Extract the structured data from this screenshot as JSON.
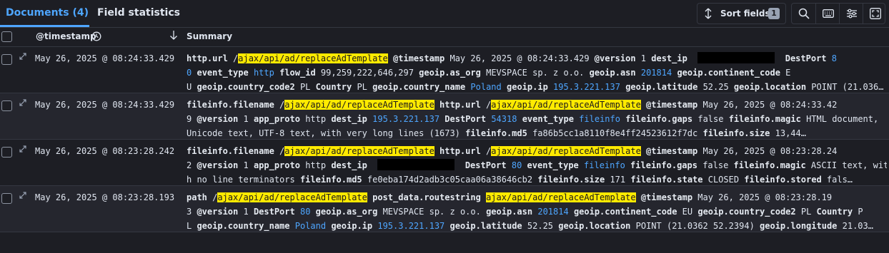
{
  "tabs": [
    {
      "label": "Documents (4)",
      "active": true
    },
    {
      "label": "Field statistics",
      "active": false
    }
  ],
  "toolbar": {
    "sort_label": "Sort fields",
    "sort_count": "1",
    "icons": [
      "search-icon",
      "keyboard-icon",
      "settings-sliders-icon",
      "fullscreen-icon"
    ]
  },
  "columns": {
    "timestamp": "@timestamp",
    "summary": "Summary"
  },
  "colors": {
    "accent": "#4ea6ff",
    "highlight": "#ffea00",
    "background": "#1d1e24"
  },
  "rows": [
    {
      "timestamp": "May 26, 2025 @ 08:24:33.429",
      "lines": [
        [
          [
            "k",
            "http.url"
          ],
          [
            "t",
            " /"
          ],
          [
            "h",
            "ajax/api/ad/replaceAdTemplate"
          ],
          [
            "t",
            " "
          ],
          [
            "k",
            "@timestamp"
          ],
          [
            "t",
            " May 26, 2025 @ 08:24:33.429 "
          ],
          [
            "k",
            "@version"
          ],
          [
            "t",
            " 1 "
          ],
          [
            "k",
            "dest_ip"
          ],
          [
            "t",
            "  "
          ],
          [
            "r",
            ""
          ],
          [
            "t",
            "  "
          ],
          [
            "k",
            "DestPort"
          ],
          [
            "t",
            " "
          ],
          [
            "n",
            "8"
          ]
        ],
        [
          [
            "n",
            "0"
          ],
          [
            "t",
            " "
          ],
          [
            "k",
            "event_type"
          ],
          [
            "t",
            " "
          ],
          [
            "n",
            "http"
          ],
          [
            "t",
            " "
          ],
          [
            "k",
            "flow_id"
          ],
          [
            "t",
            " 99,259,222,646,297 "
          ],
          [
            "k",
            "geoip.as_org"
          ],
          [
            "t",
            " MEVSPACE sp. z o.o. "
          ],
          [
            "k",
            "geoip.asn"
          ],
          [
            "t",
            " "
          ],
          [
            "n",
            "201814"
          ],
          [
            "t",
            " "
          ],
          [
            "k",
            "geoip.continent_code"
          ],
          [
            "t",
            " E"
          ]
        ],
        [
          [
            "t",
            "U "
          ],
          [
            "k",
            "geoip.country_code2"
          ],
          [
            "t",
            " PL "
          ],
          [
            "k",
            "Country"
          ],
          [
            "t",
            " PL "
          ],
          [
            "k",
            "geoip.country_name"
          ],
          [
            "t",
            " "
          ],
          [
            "n",
            "Poland"
          ],
          [
            "t",
            " "
          ],
          [
            "k",
            "geoip.ip"
          ],
          [
            "t",
            " "
          ],
          [
            "n",
            "195.3.221.137"
          ],
          [
            "t",
            " "
          ],
          [
            "k",
            "geoip.latitude"
          ],
          [
            "t",
            " 52.25 "
          ],
          [
            "k",
            "geoip.location"
          ],
          [
            "t",
            " POINT (21.036…"
          ]
        ]
      ]
    },
    {
      "timestamp": "May 26, 2025 @ 08:24:33.429",
      "lines": [
        [
          [
            "k",
            "fileinfo.filename"
          ],
          [
            "t",
            " /"
          ],
          [
            "h",
            "ajax/api/ad/replaceAdTemplate"
          ],
          [
            "t",
            " "
          ],
          [
            "k",
            "http.url"
          ],
          [
            "t",
            " /"
          ],
          [
            "h",
            "ajax/api/ad/replaceAdTemplate"
          ],
          [
            "t",
            " "
          ],
          [
            "k",
            "@timestamp"
          ],
          [
            "t",
            " May 26, 2025 @ 08:24:33.42"
          ]
        ],
        [
          [
            "t",
            "9 "
          ],
          [
            "k",
            "@version"
          ],
          [
            "t",
            " 1 "
          ],
          [
            "k",
            "app_proto"
          ],
          [
            "t",
            " http "
          ],
          [
            "k",
            "dest_ip"
          ],
          [
            "t",
            " "
          ],
          [
            "n",
            "195.3.221.137"
          ],
          [
            "t",
            " "
          ],
          [
            "k",
            "DestPort"
          ],
          [
            "t",
            " "
          ],
          [
            "n",
            "54318"
          ],
          [
            "t",
            " "
          ],
          [
            "k",
            "event_type"
          ],
          [
            "t",
            " "
          ],
          [
            "n",
            "fileinfo"
          ],
          [
            "t",
            " "
          ],
          [
            "k",
            "fileinfo.gaps"
          ],
          [
            "t",
            " false "
          ],
          [
            "k",
            "fileinfo.magic"
          ],
          [
            "t",
            " HTML document,"
          ]
        ],
        [
          [
            "t",
            "Unicode text, UTF-8 text, with very long lines (1673) "
          ],
          [
            "k",
            "fileinfo.md5"
          ],
          [
            "t",
            " fa86b5cc1a8110f8e4ff24523612f7dc "
          ],
          [
            "k",
            "fileinfo.size"
          ],
          [
            "t",
            " 13,44…"
          ]
        ]
      ]
    },
    {
      "timestamp": "May 26, 2025 @ 08:23:28.242",
      "lines": [
        [
          [
            "k",
            "fileinfo.filename"
          ],
          [
            "t",
            " /"
          ],
          [
            "h",
            "ajax/api/ad/replaceAdTemplate"
          ],
          [
            "t",
            " "
          ],
          [
            "k",
            "http.url"
          ],
          [
            "t",
            " /"
          ],
          [
            "h",
            "ajax/api/ad/replaceAdTemplate"
          ],
          [
            "t",
            " "
          ],
          [
            "k",
            "@timestamp"
          ],
          [
            "t",
            " May 26, 2025 @ 08:23:28.24"
          ]
        ],
        [
          [
            "t",
            "2 "
          ],
          [
            "k",
            "@version"
          ],
          [
            "t",
            " 1 "
          ],
          [
            "k",
            "app_proto"
          ],
          [
            "t",
            " http "
          ],
          [
            "k",
            "dest_ip"
          ],
          [
            "t",
            "  "
          ],
          [
            "r",
            ""
          ],
          [
            "t",
            "  "
          ],
          [
            "k",
            "DestPort"
          ],
          [
            "t",
            " "
          ],
          [
            "n",
            "80"
          ],
          [
            "t",
            " "
          ],
          [
            "k",
            "event_type"
          ],
          [
            "t",
            " "
          ],
          [
            "n",
            "fileinfo"
          ],
          [
            "t",
            " "
          ],
          [
            "k",
            "fileinfo.gaps"
          ],
          [
            "t",
            " false "
          ],
          [
            "k",
            "fileinfo.magic"
          ],
          [
            "t",
            " ASCII text, wit"
          ]
        ],
        [
          [
            "t",
            "h no line terminators "
          ],
          [
            "k",
            "fileinfo.md5"
          ],
          [
            "t",
            " fe0eba174d2adb3c05caa06a38646cb2 "
          ],
          [
            "k",
            "fileinfo.size"
          ],
          [
            "t",
            " 171 "
          ],
          [
            "k",
            "fileinfo.state"
          ],
          [
            "t",
            " CLOSED "
          ],
          [
            "k",
            "fileinfo.stored"
          ],
          [
            "t",
            " fals…"
          ]
        ]
      ]
    },
    {
      "timestamp": "May 26, 2025 @ 08:23:28.193",
      "lines": [
        [
          [
            "k",
            "path"
          ],
          [
            "t",
            " /"
          ],
          [
            "h",
            "ajax/api/ad/replaceAdTemplate"
          ],
          [
            "t",
            " "
          ],
          [
            "k",
            "post_data.routestring"
          ],
          [
            "t",
            " "
          ],
          [
            "h",
            "ajax/api/ad/replaceAdTemplate"
          ],
          [
            "t",
            " "
          ],
          [
            "k",
            "@timestamp"
          ],
          [
            "t",
            " May 26, 2025 @ 08:23:28.19"
          ]
        ],
        [
          [
            "t",
            "3 "
          ],
          [
            "k",
            "@version"
          ],
          [
            "t",
            " 1 "
          ],
          [
            "k",
            "DestPort"
          ],
          [
            "t",
            " "
          ],
          [
            "n",
            "80"
          ],
          [
            "t",
            " "
          ],
          [
            "k",
            "geoip.as_org"
          ],
          [
            "t",
            " MEVSPACE sp. z o.o. "
          ],
          [
            "k",
            "geoip.asn"
          ],
          [
            "t",
            " "
          ],
          [
            "n",
            "201814"
          ],
          [
            "t",
            " "
          ],
          [
            "k",
            "geoip.continent_code"
          ],
          [
            "t",
            " EU "
          ],
          [
            "k",
            "geoip.country_code2"
          ],
          [
            "t",
            " PL "
          ],
          [
            "k",
            "Country"
          ],
          [
            "t",
            " P"
          ]
        ],
        [
          [
            "t",
            "L "
          ],
          [
            "k",
            "geoip.country_name"
          ],
          [
            "t",
            " "
          ],
          [
            "n",
            "Poland"
          ],
          [
            "t",
            " "
          ],
          [
            "k",
            "geoip.ip"
          ],
          [
            "t",
            " "
          ],
          [
            "n",
            "195.3.221.137"
          ],
          [
            "t",
            " "
          ],
          [
            "k",
            "geoip.latitude"
          ],
          [
            "t",
            " 52.25 "
          ],
          [
            "k",
            "geoip.location"
          ],
          [
            "t",
            " POINT (21.0362 52.2394) "
          ],
          [
            "k",
            "geoip.longitude"
          ],
          [
            "t",
            " 21.03…"
          ]
        ]
      ]
    }
  ]
}
